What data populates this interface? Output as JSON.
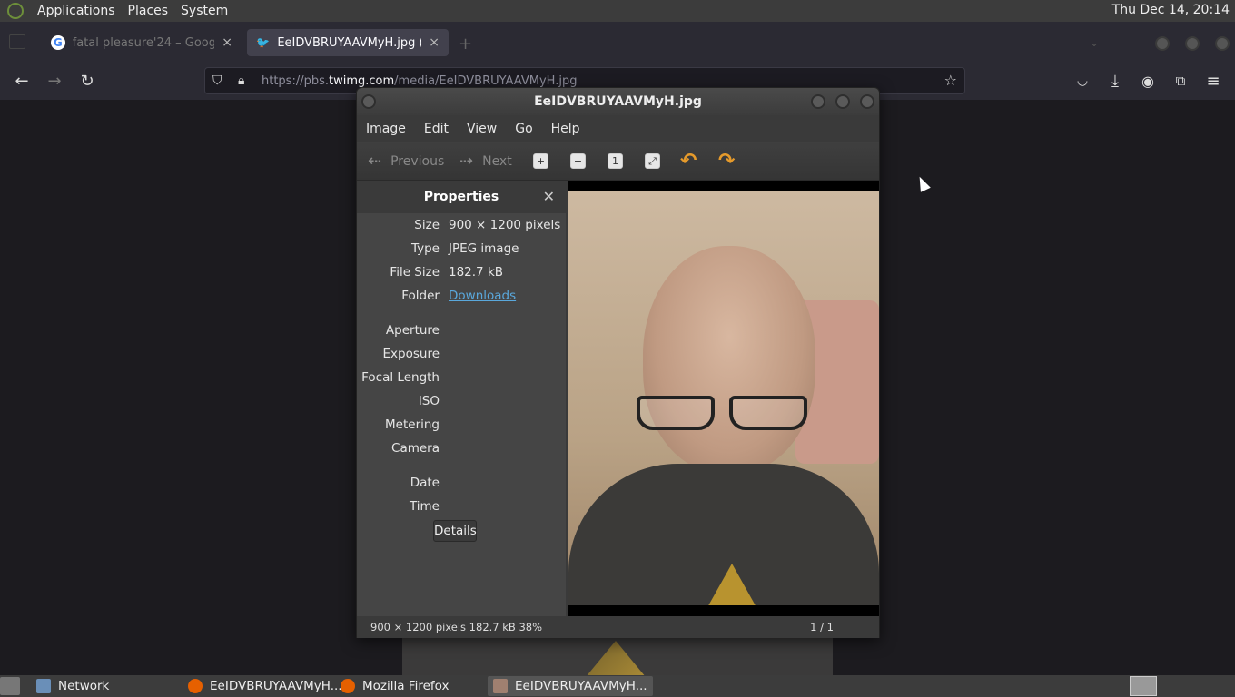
{
  "top_panel": {
    "menus": [
      "Applications",
      "Places",
      "System"
    ],
    "clock": "Thu Dec 14, 20:14"
  },
  "firefox": {
    "tabs": [
      {
        "title": "fatal pleasure'24 – Goog",
        "active": false
      },
      {
        "title": "EeIDVBRUYAAVMyH.jpg (JP",
        "active": true
      }
    ],
    "new_tab": "+",
    "url_prefix": "https://pbs.",
    "url_host": "twimg.com",
    "url_path": "/media/EeIDVBRUYAAVMyH.jpg"
  },
  "eog": {
    "title": "EeIDVBRUYAAVMyH.jpg",
    "menu": [
      "Image",
      "Edit",
      "View",
      "Go",
      "Help"
    ],
    "toolbar": {
      "previous": "Previous",
      "next": "Next"
    },
    "sidebar": {
      "title": "Properties",
      "rows": [
        {
          "key": "Size",
          "value": "900 × 1200 pixels"
        },
        {
          "key": "Type",
          "value": "JPEG image"
        },
        {
          "key": "File Size",
          "value": "182.7 kB"
        },
        {
          "key": "Folder",
          "value": "Downloads"
        },
        {
          "key": "Aperture",
          "value": ""
        },
        {
          "key": "Exposure",
          "value": ""
        },
        {
          "key": "Focal Length",
          "value": ""
        },
        {
          "key": "ISO",
          "value": ""
        },
        {
          "key": "Metering",
          "value": ""
        },
        {
          "key": "Camera",
          "value": ""
        },
        {
          "key": "Date",
          "value": ""
        },
        {
          "key": "Time",
          "value": ""
        }
      ],
      "details_label": "Details"
    },
    "status": {
      "left": "900 × 1200 pixels  182.7 kB    38%",
      "right": "1 / 1"
    }
  },
  "taskbar": {
    "items": [
      {
        "label": "Network",
        "active": false
      },
      {
        "label": "EeIDVBRUYAAVMyH...",
        "active": false
      },
      {
        "label": "Mozilla Firefox",
        "active": false
      },
      {
        "label": "EeIDVBRUYAAVMyH...",
        "active": true
      }
    ]
  },
  "colors": {
    "link": "#5aa8dc",
    "accent_orange": "#e59a2b",
    "panel": "#3c3c3c"
  }
}
